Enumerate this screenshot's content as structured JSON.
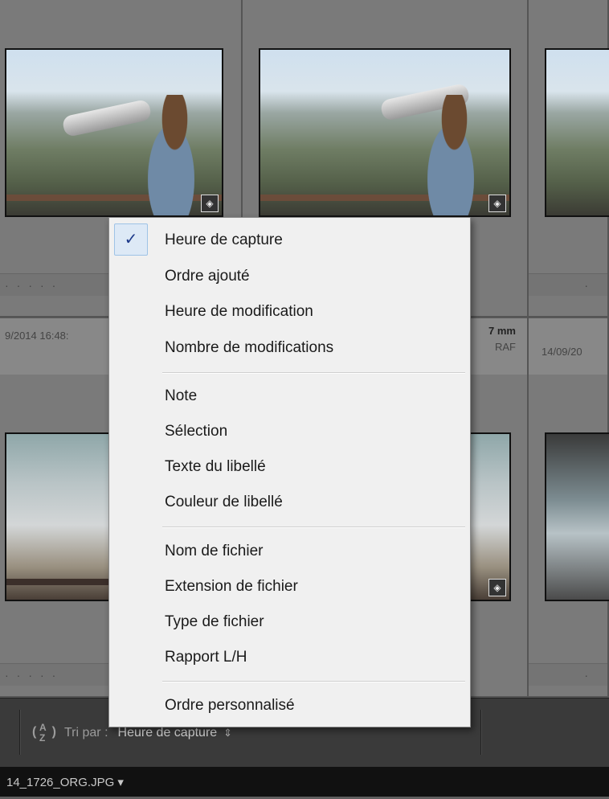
{
  "grid": {
    "row1": {
      "meta_left": "9/2014 16:48:",
      "meta_mid_focal": "7 mm",
      "meta_mid_ext": "RAF",
      "meta_right": "14/09/20"
    }
  },
  "menu": {
    "checkmark": "✓",
    "groups": [
      [
        "Heure de capture",
        "Ordre ajouté",
        "Heure de modification",
        "Nombre de modifications"
      ],
      [
        "Note",
        "Sélection",
        "Texte du libellé",
        "Couleur de libellé"
      ],
      [
        "Nom de fichier",
        "Extension de fichier",
        "Type de fichier",
        "Rapport L/H"
      ],
      [
        "Ordre personnalisé"
      ]
    ],
    "selected": "Heure de capture"
  },
  "toolbar": {
    "sort_icon_a": "A",
    "sort_icon_z": "Z",
    "sort_label": "Tri par :",
    "sort_value": "Heure de capture",
    "sort_caret": "⇕"
  },
  "filmstrip": {
    "text": "14_1726_ORG.JPG ▾"
  },
  "badge_glyph": "◈"
}
